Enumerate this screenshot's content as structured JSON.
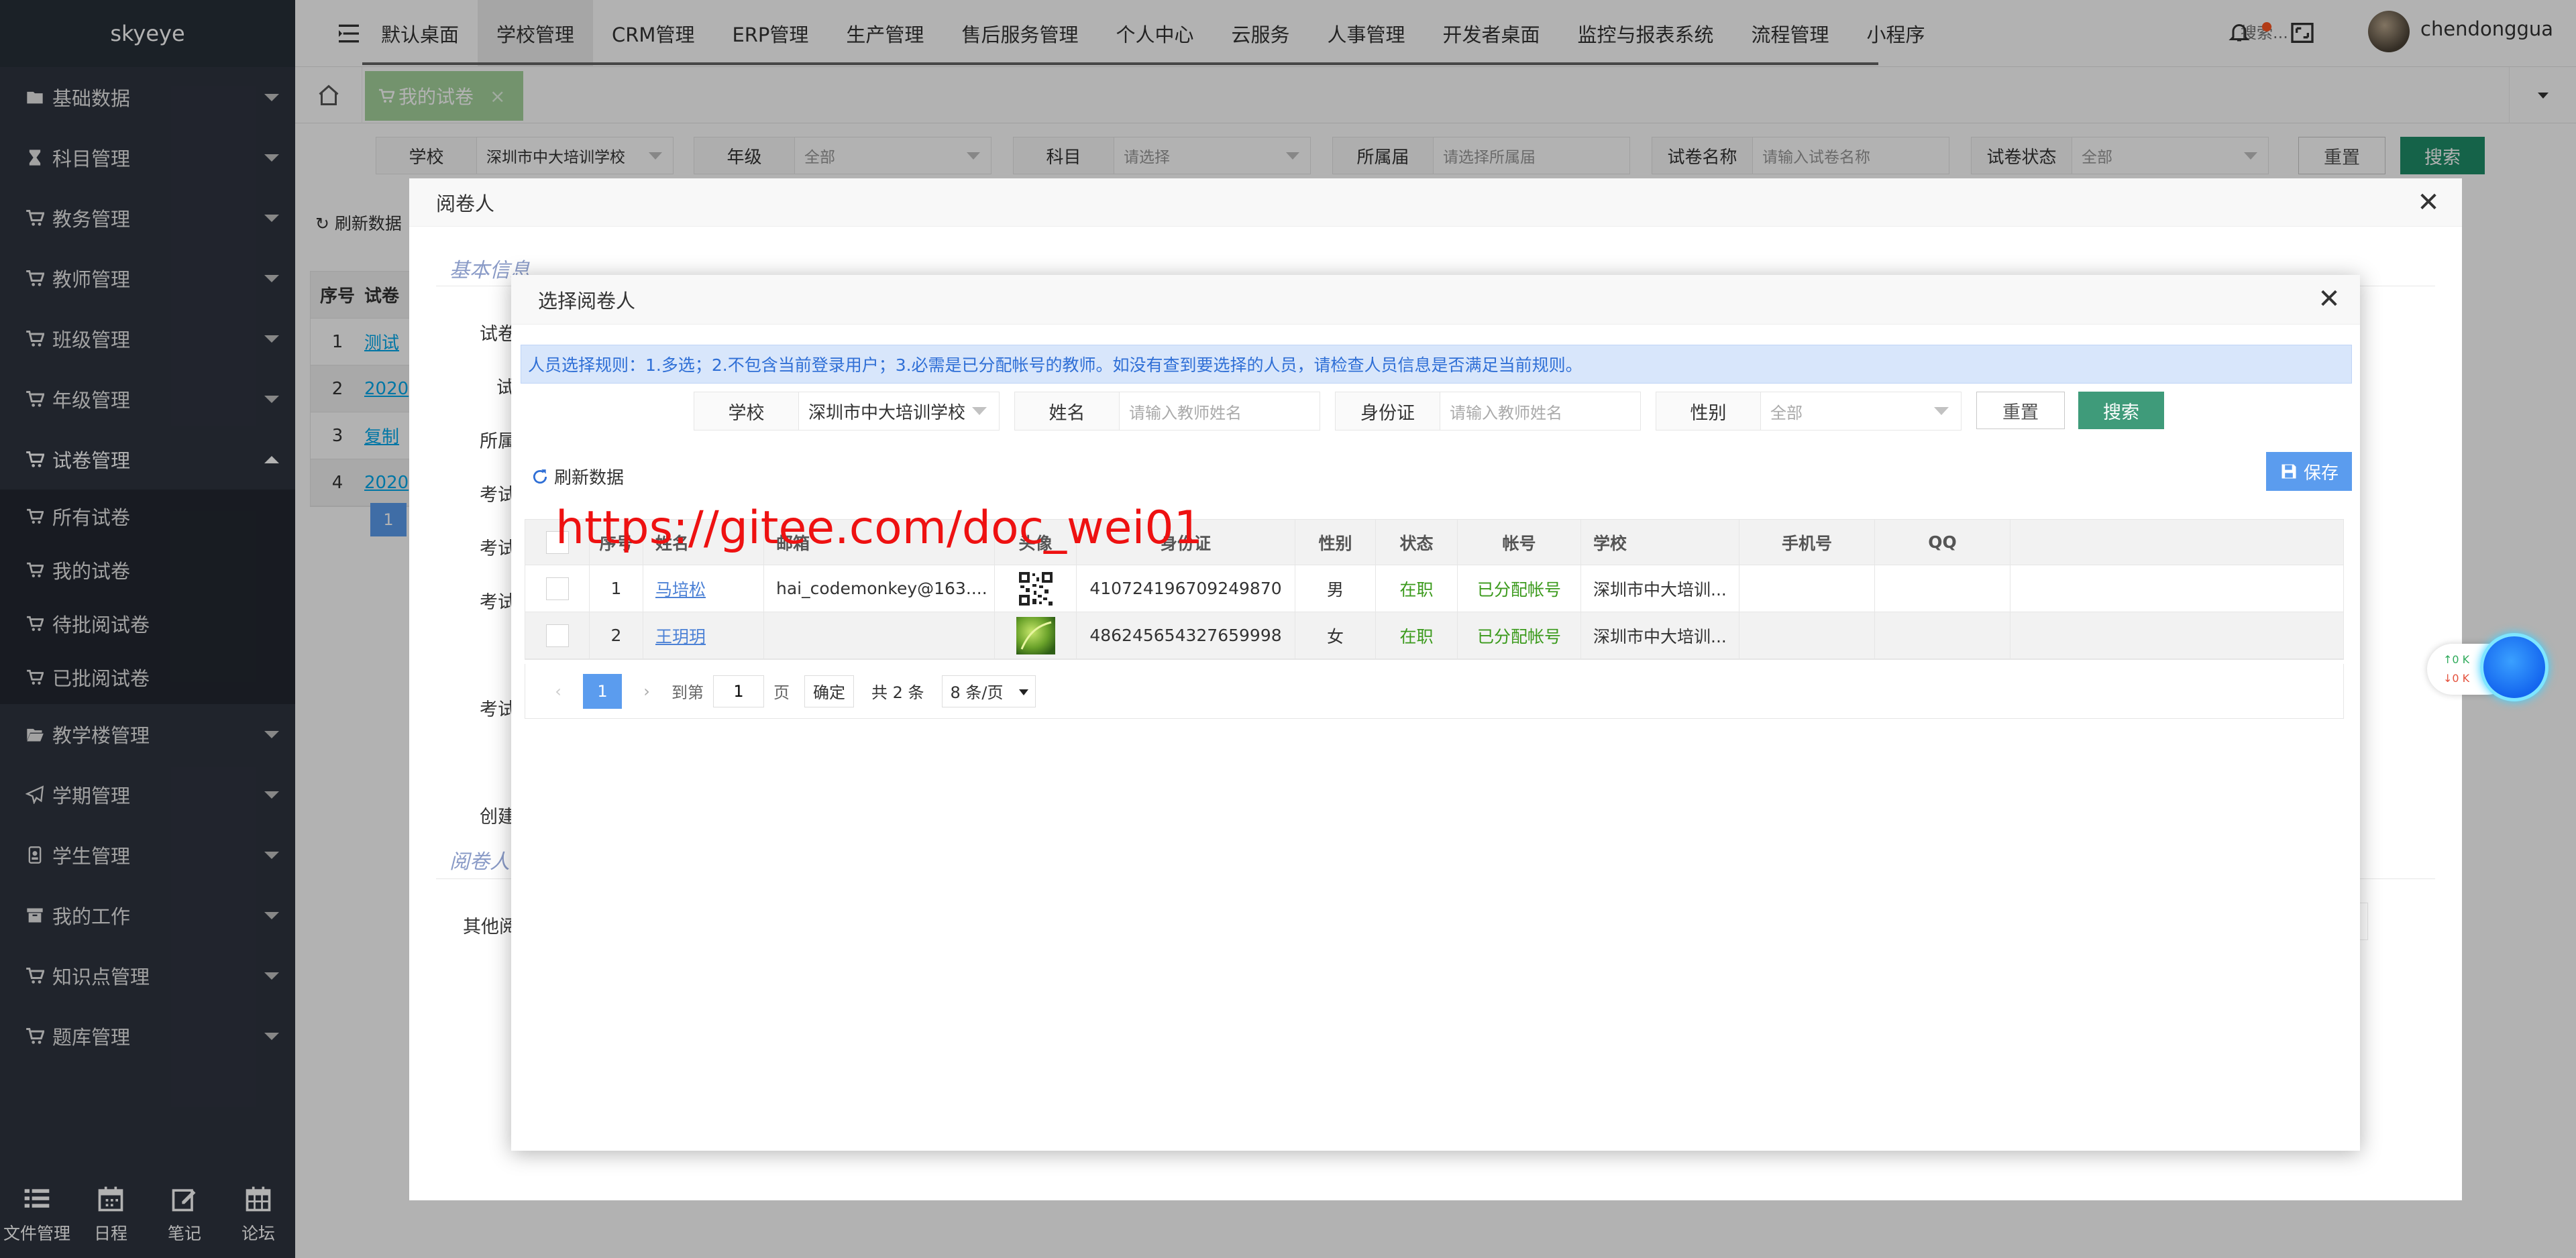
{
  "app": {
    "logo": "skyeye",
    "username": "chendonggua"
  },
  "sidebar": {
    "items": [
      {
        "label": "基础数据",
        "icon": "folder-icon"
      },
      {
        "label": "科目管理",
        "icon": "hourglass-icon"
      },
      {
        "label": "教务管理",
        "icon": "cart-icon"
      },
      {
        "label": "教师管理",
        "icon": "cart-icon"
      },
      {
        "label": "班级管理",
        "icon": "cart-icon"
      },
      {
        "label": "年级管理",
        "icon": "cart-icon"
      },
      {
        "label": "试卷管理",
        "icon": "cart-icon"
      }
    ],
    "sub_items": [
      {
        "label": "所有试卷"
      },
      {
        "label": "我的试卷"
      },
      {
        "label": "待批阅试卷"
      },
      {
        "label": "已批阅试卷"
      }
    ],
    "items_after": [
      {
        "label": "教学楼管理",
        "icon": "folder-open-icon"
      },
      {
        "label": "学期管理",
        "icon": "paper-plane-icon"
      },
      {
        "label": "学生管理",
        "icon": "id-badge-icon"
      },
      {
        "label": "我的工作",
        "icon": "archive-icon"
      },
      {
        "label": "知识点管理",
        "icon": "cart-icon"
      },
      {
        "label": "题库管理",
        "icon": "cart-icon"
      }
    ],
    "bottom": [
      {
        "label": "文件管理",
        "icon": "list-icon"
      },
      {
        "label": "日程",
        "icon": "calendar-icon"
      },
      {
        "label": "笔记",
        "icon": "edit-icon"
      },
      {
        "label": "论坛",
        "icon": "calendar-grid-icon"
      }
    ]
  },
  "topnav": {
    "items": [
      "默认桌面",
      "学校管理",
      "CRM管理",
      "ERP管理",
      "生产管理",
      "售后服务管理",
      "个人中心",
      "云服务",
      "人事管理",
      "开发者桌面",
      "监控与报表系统",
      "流程管理",
      "小程序"
    ],
    "active_index": 1,
    "search_placeholder": "搜索..."
  },
  "tabs": {
    "current": "我的试卷",
    "close": "×"
  },
  "bg_filters": {
    "school": {
      "label": "学校",
      "value": "深圳市中大培训学校"
    },
    "grade": {
      "label": "年级",
      "value": "全部"
    },
    "subject": {
      "label": "科目",
      "value": "请选择"
    },
    "session": {
      "label": "所属届",
      "value": "请选择所属届"
    },
    "paper_name": {
      "label": "试卷名称",
      "value": "请输入试卷名称"
    },
    "paper_status": {
      "label": "试卷状态",
      "value": "全部"
    },
    "reset": "重置",
    "search": "搜索"
  },
  "bg_list": {
    "refresh": "刷新数据",
    "col_index": "序号",
    "col_name": "试卷",
    "rows": [
      {
        "index": "1",
        "name": "测试"
      },
      {
        "index": "2",
        "name": "2020"
      },
      {
        "index": "3",
        "name": "复制"
      },
      {
        "index": "4",
        "name": "2020"
      }
    ],
    "page": "1"
  },
  "outer_dialog": {
    "title": "阅卷人",
    "close": "✕",
    "section_basic": "基本信息",
    "section_reader": "阅卷人",
    "labels": [
      "试卷",
      "试",
      "所属",
      "考试",
      "考试",
      "考试",
      "考试",
      "创建"
    ],
    "other_label": "其他阅"
  },
  "dialog": {
    "title": "选择阅卷人",
    "close": "✕",
    "rule": "人员选择规则：1.多选；2.不包含当前登录用户；3.必需是已分配帐号的教师。如没有查到要选择的人员，请检查人员信息是否满足当前规则。",
    "filters": {
      "school": {
        "label": "学校",
        "value": "深圳市中大培训学校"
      },
      "name": {
        "label": "姓名",
        "placeholder": "请输入教师姓名"
      },
      "idcard": {
        "label": "身份证",
        "placeholder": "请输入教师姓名"
      },
      "gender": {
        "label": "性别",
        "value": "全部"
      }
    },
    "reset": "重置",
    "search": "搜索",
    "refresh": "刷新数据",
    "save": "保存",
    "columns": [
      "序号",
      "姓名",
      "邮箱",
      "头像",
      "身份证",
      "性别",
      "状态",
      "帐号",
      "学校",
      "手机号",
      "QQ"
    ],
    "rows": [
      {
        "index": "1",
        "name": "马培松",
        "email": "hai_codemonkey@163....",
        "avatar": "qr-code",
        "idcard": "410724196709249870",
        "gender": "男",
        "status": "在职",
        "account": "已分配帐号",
        "school": "深圳市中大培训...",
        "phone": "",
        "qq": ""
      },
      {
        "index": "2",
        "name": "王玥玥",
        "email": "",
        "avatar": "leaf-photo",
        "idcard": "486245654327659998",
        "gender": "女",
        "status": "在职",
        "account": "已分配帐号",
        "school": "深圳市中大培训...",
        "phone": "",
        "qq": ""
      }
    ],
    "pager": {
      "current": "1",
      "goto": "到第",
      "page_input": "1",
      "page_unit": "页",
      "confirm": "确定",
      "total": "共 2 条",
      "per_page": "8 条/页"
    }
  },
  "watermark": "https://gitee.com/doc_wei01",
  "net_widget": {
    "up": "↑0 K",
    "down": "↓0 K"
  },
  "colors": {
    "sidebar_bg": "#2f3440",
    "accent_blue": "#5b9cee",
    "accent_green": "#1f8f69",
    "tab_green": "#a5d39c",
    "watermark_red": "#ee1111"
  }
}
